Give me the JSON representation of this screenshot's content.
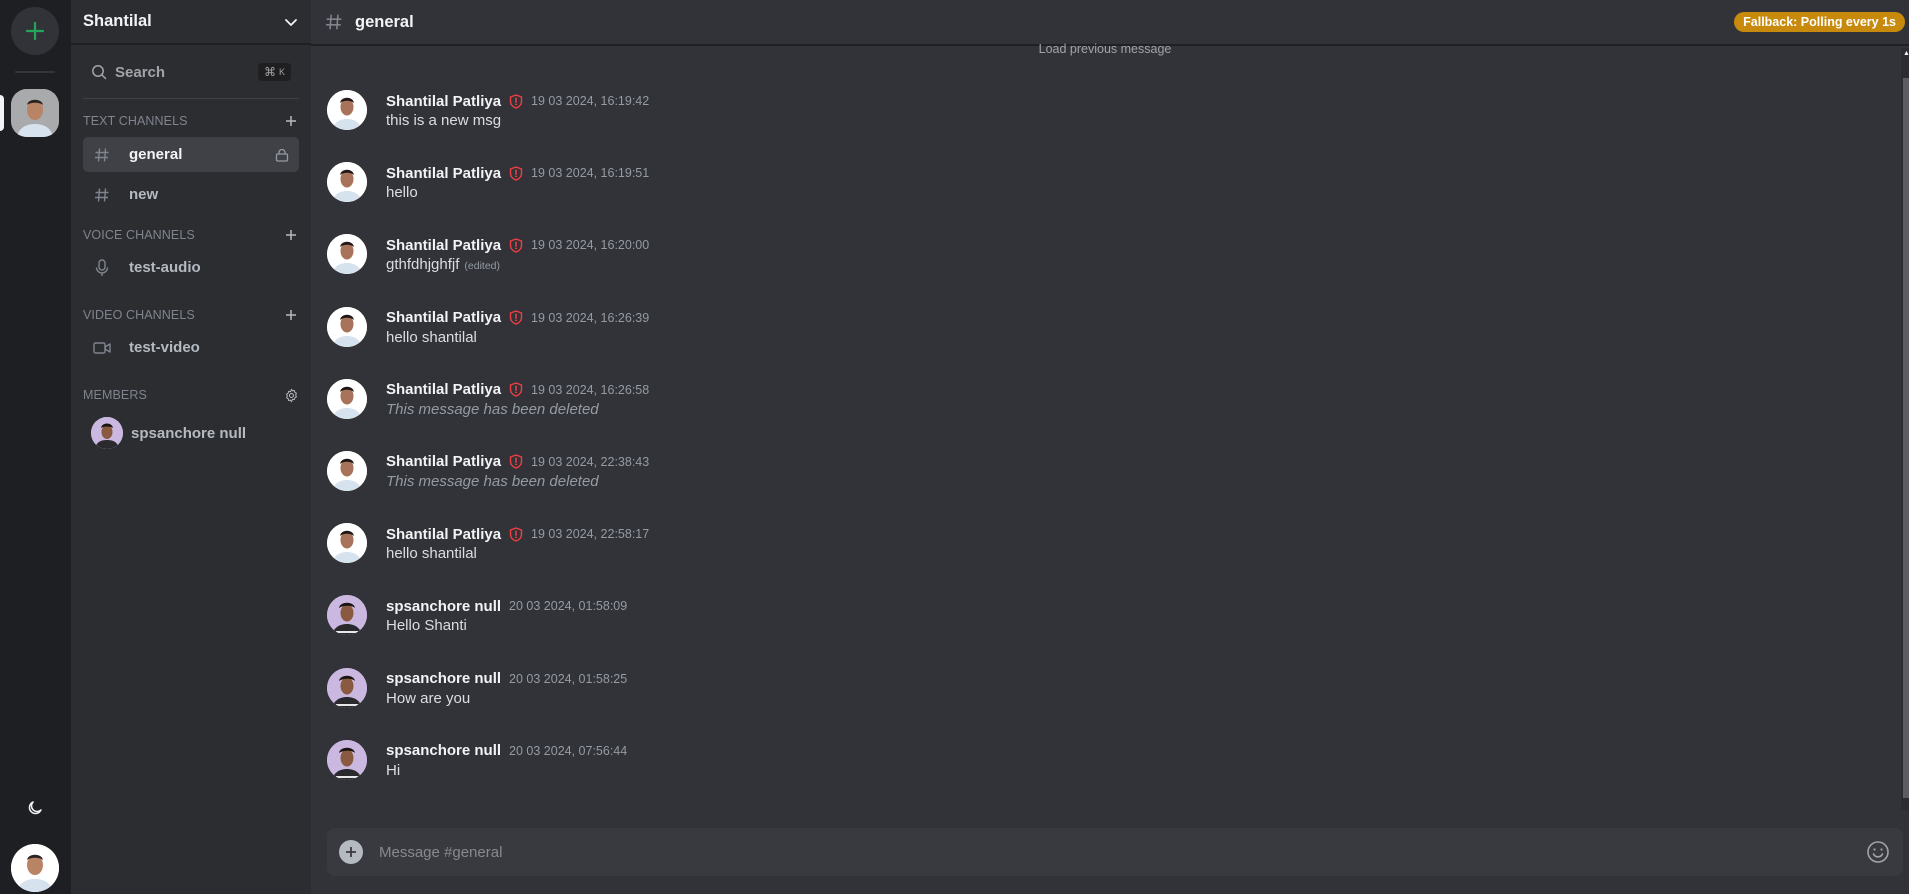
{
  "server": {
    "name": "Shantilal",
    "add_server_label": "+"
  },
  "search": {
    "label": "Search",
    "shortcut_symbol": "⌘",
    "shortcut_key": "K"
  },
  "sections": {
    "text": {
      "title": "Text Channels",
      "channels": [
        {
          "name": "general",
          "active": true,
          "locked": true
        },
        {
          "name": "new",
          "active": false,
          "locked": false
        }
      ]
    },
    "voice": {
      "title": "Voice Channels",
      "channels": [
        {
          "name": "test-audio"
        }
      ]
    },
    "video": {
      "title": "Video Channels",
      "channels": [
        {
          "name": "test-video"
        }
      ]
    },
    "members": {
      "title": "Members",
      "list": [
        {
          "name": "spsanchore null"
        }
      ]
    }
  },
  "header": {
    "channel": "general",
    "badge": "Fallback: Polling every 1s",
    "badge_color": "#c88a0c"
  },
  "load_previous": "Load previous message",
  "messages": [
    {
      "author": "Shantilal Patliya",
      "admin": true,
      "timestamp": "19 03 2024, 16:19:42",
      "text": "this is a new msg",
      "deleted": false,
      "edited": false
    },
    {
      "author": "Shantilal Patliya",
      "admin": true,
      "timestamp": "19 03 2024, 16:19:51",
      "text": "hello",
      "deleted": false,
      "edited": false
    },
    {
      "author": "Shantilal Patliya",
      "admin": true,
      "timestamp": "19 03 2024, 16:20:00",
      "text": "gthfdhjghfjf",
      "deleted": false,
      "edited": true
    },
    {
      "author": "Shantilal Patliya",
      "admin": true,
      "timestamp": "19 03 2024, 16:26:39",
      "text": "hello shantilal",
      "deleted": false,
      "edited": false
    },
    {
      "author": "Shantilal Patliya",
      "admin": true,
      "timestamp": "19 03 2024, 16:26:58",
      "text": "This message has been deleted",
      "deleted": true,
      "edited": false
    },
    {
      "author": "Shantilal Patliya",
      "admin": true,
      "timestamp": "19 03 2024, 22:38:43",
      "text": "This message has been deleted",
      "deleted": true,
      "edited": false
    },
    {
      "author": "Shantilal Patliya",
      "admin": true,
      "timestamp": "19 03 2024, 22:58:17",
      "text": "hello shantilal",
      "deleted": false,
      "edited": false
    },
    {
      "author": "spsanchore null",
      "admin": false,
      "timestamp": "20 03 2024, 01:58:09",
      "text": "Hello Shanti",
      "deleted": false,
      "edited": false
    },
    {
      "author": "spsanchore null",
      "admin": false,
      "timestamp": "20 03 2024, 01:58:25",
      "text": "How are you",
      "deleted": false,
      "edited": false
    },
    {
      "author": "spsanchore null",
      "admin": false,
      "timestamp": "20 03 2024, 07:56:44",
      "text": "Hi",
      "deleted": false,
      "edited": false
    }
  ],
  "edited_label": "(edited)",
  "composer": {
    "placeholder": "Message #general",
    "value": ""
  },
  "colors": {
    "accent_green": "#23a55a",
    "admin_shield": "#f23f43",
    "badge": "#c88a0c"
  }
}
